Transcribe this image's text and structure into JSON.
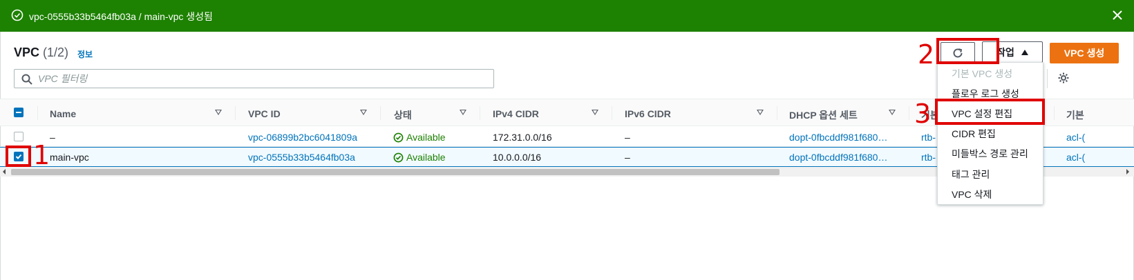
{
  "flash": {
    "message": "vpc-0555b33b5464fb03a / main-vpc 생성됨",
    "color": "#1d8102"
  },
  "header": {
    "title": "VPC",
    "count": "(1/2)",
    "info_label": "정보",
    "actions_label": "작업",
    "create_label": "VPC 생성"
  },
  "search": {
    "placeholder": "VPC 필터링",
    "value": ""
  },
  "table": {
    "columns": [
      "Name",
      "VPC ID",
      "상태",
      "IPv4 CIDR",
      "IPv6 CIDR",
      "DHCP 옵션 세트",
      "기본",
      "기본"
    ],
    "rows": [
      {
        "name": "–",
        "vpc_id": "vpc-06899b2bc6041809a",
        "status": "Available",
        "ipv4": "172.31.0.0/16",
        "ipv6": "–",
        "dhcp": "dopt-0fbcddf981f680…",
        "rtb": "rtb-",
        "acl": "acl-(",
        "selected": false
      },
      {
        "name": "main-vpc",
        "vpc_id": "vpc-0555b33b5464fb03a",
        "status": "Available",
        "ipv4": "10.0.0.0/16",
        "ipv6": "–",
        "dhcp": "dopt-0fbcddf981f680…",
        "rtb": "rtb-",
        "acl": "acl-(",
        "selected": true
      }
    ]
  },
  "actions_menu": {
    "items": [
      {
        "label": "기본 VPC 생성",
        "disabled": true
      },
      {
        "label": "플로우 로그 생성",
        "disabled": false
      },
      {
        "label": "VPC 설정 편집",
        "disabled": false
      },
      {
        "label": "CIDR 편집",
        "disabled": false
      },
      {
        "label": "미들박스 경로 관리",
        "disabled": false
      },
      {
        "label": "태그 관리",
        "disabled": false
      },
      {
        "label": "VPC 삭제",
        "disabled": false
      }
    ]
  },
  "annotations": {
    "step1": "1",
    "step2": "2",
    "step3": "3",
    "color": "#e00000"
  },
  "colors": {
    "link": "#0073bb",
    "primary": "#ec7211",
    "success": "#1d8102"
  }
}
